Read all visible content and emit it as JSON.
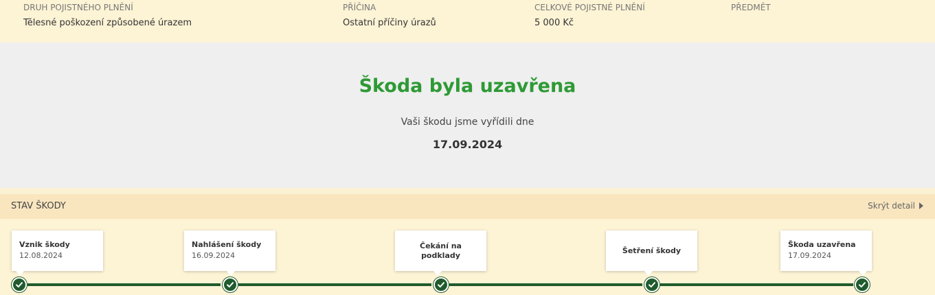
{
  "info": {
    "druh": {
      "label": "DRUH POJISTNÉHO PLNĚNÍ",
      "value": "Tělesné poškození způsobené úrazem"
    },
    "pricina": {
      "label": "PŘÍČINA",
      "value": "Ostatní příčiny úrazů"
    },
    "celkove": {
      "label": "CELKOVÉ POJISTNÉ PLNĚNÍ",
      "value": "5 000 Kč"
    },
    "predmet": {
      "label": "PŘEDMĚT",
      "value": ""
    }
  },
  "status": {
    "title": "Škoda byla uzavřena",
    "subtitle": "Vaši škodu jsme vyřídili dne",
    "date": "17.09.2024"
  },
  "section": {
    "title": "STAV ŠKODY",
    "toggle_label": "Skrýt detail"
  },
  "timeline": {
    "steps": [
      {
        "name": "Vznik škody",
        "date": "12.08.2024",
        "completed": true
      },
      {
        "name": "Nahlášení škody",
        "date": "16.09.2024",
        "completed": true
      },
      {
        "name": "Čekání na podklady",
        "date": "",
        "completed": true
      },
      {
        "name": "Šetření škody",
        "date": "",
        "completed": true
      },
      {
        "name": "Škoda uzavřena",
        "date": "17.09.2024",
        "completed": true
      }
    ]
  },
  "colors": {
    "accent_green": "#2e9a35",
    "timeline_green": "#1f5b2c",
    "background_cream": "#fdf3d5",
    "panel_gray": "#efefef"
  }
}
